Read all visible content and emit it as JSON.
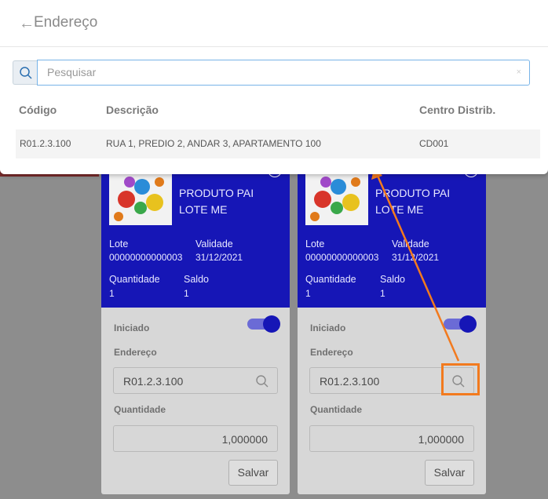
{
  "modal": {
    "title": "Endereço",
    "search_placeholder": "Pesquisar",
    "clear_symbol": "×",
    "columns": [
      "Código",
      "Descrição",
      "Centro Distrib."
    ],
    "rows": [
      {
        "codigo": "R01.2.3.100",
        "descricao": "RUA 1, PREDIO 2, ANDAR 3, APARTAMENTO 100",
        "centro": "CD001"
      }
    ]
  },
  "cards": [
    {
      "product_line1": "PRODUTO PAI",
      "product_line2": "LOTE ME",
      "lote_label": "Lote",
      "lote_value": "00000000000003",
      "validade_label": "Validade",
      "validade_value": "31/12/2021",
      "quantidade_label": "Quantidade",
      "quantidade_value": "1",
      "saldo_label": "Saldo",
      "saldo_value": "1",
      "iniciado_label": "Iniciado",
      "endereco_label": "Endereço",
      "endereco_value": "R01.2.3.100",
      "qty_label": "Quantidade",
      "qty_value": "1,000000",
      "save_label": "Salvar"
    },
    {
      "product_line1": "PRODUTO PAI",
      "product_line2": "LOTE ME",
      "lote_label": "Lote",
      "lote_value": "00000000000003",
      "validade_label": "Validade",
      "validade_value": "31/12/2021",
      "quantidade_label": "Quantidade",
      "quantidade_value": "1",
      "saldo_label": "Saldo",
      "saldo_value": "1",
      "iniciado_label": "Iniciado",
      "endereco_label": "Endereço",
      "endereco_value": "R01.2.3.100",
      "qty_label": "Quantidade",
      "qty_value": "1,000000",
      "save_label": "Salvar"
    }
  ],
  "colors": {
    "brand_blue": "#1616b6",
    "accent_orange": "#f27a1e",
    "focus_blue": "#78b4e8"
  },
  "icons": [
    "back-arrow-icon",
    "search-icon",
    "gears-image",
    "toggle-switch",
    "annotation-arrow"
  ]
}
